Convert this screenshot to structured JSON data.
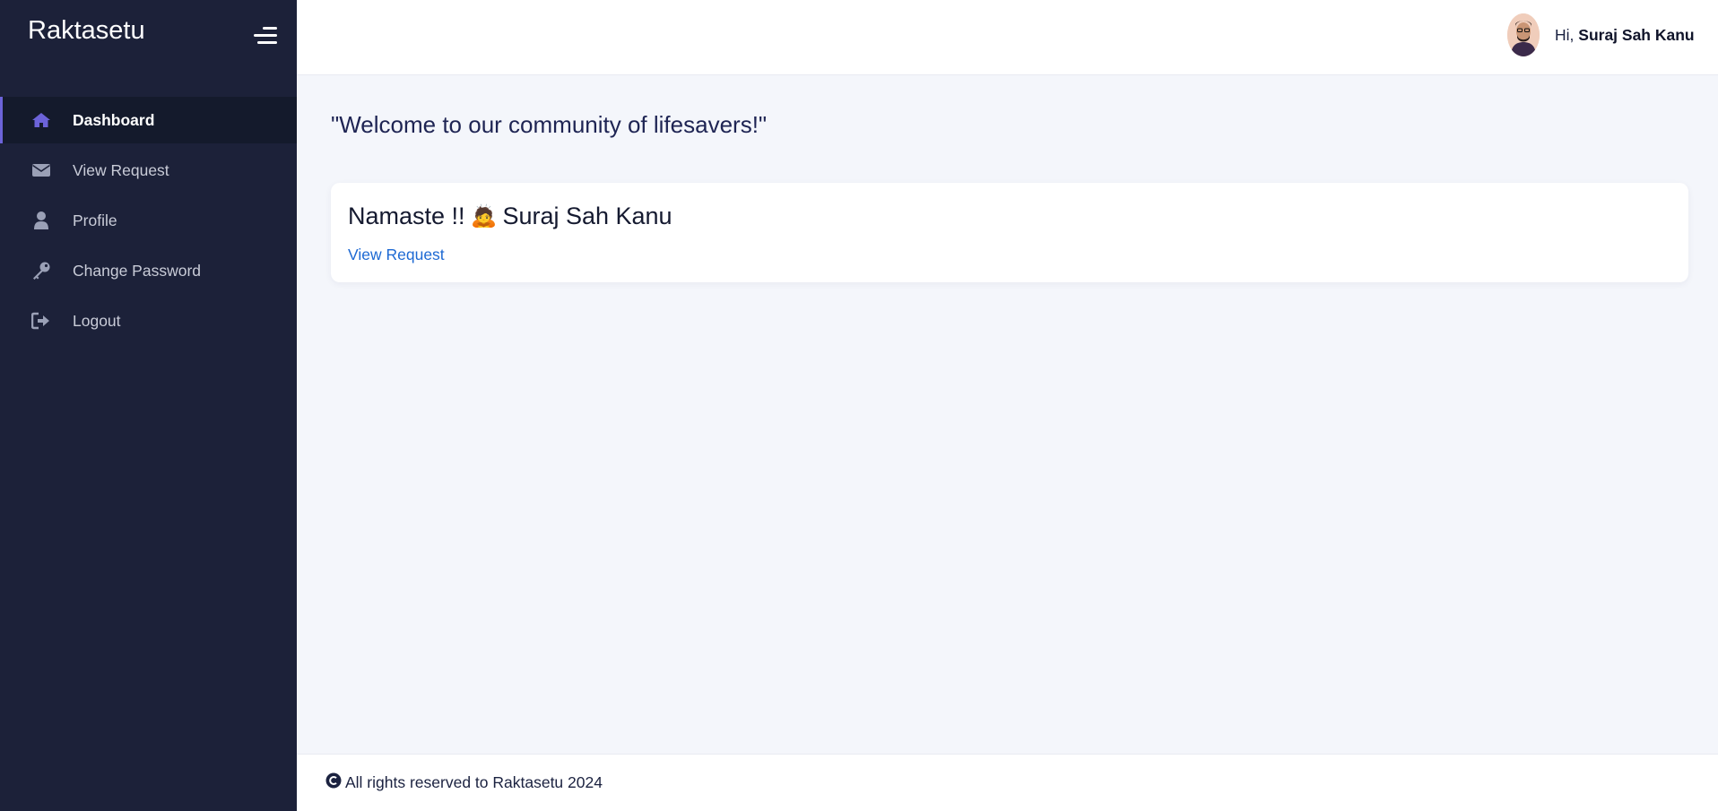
{
  "app": {
    "brand": "Raktasetu"
  },
  "sidebar": {
    "items": [
      {
        "label": "Dashboard",
        "icon": "home-icon",
        "active": true
      },
      {
        "label": "View Request",
        "icon": "envelope-icon",
        "active": false
      },
      {
        "label": "Profile",
        "icon": "user-icon",
        "active": false
      },
      {
        "label": "Change Password",
        "icon": "key-icon",
        "active": false
      },
      {
        "label": "Logout",
        "icon": "sign-out-icon",
        "active": false
      }
    ]
  },
  "header": {
    "greeting_prefix": "Hi,",
    "user_name": "Suraj Sah Kanu"
  },
  "main": {
    "welcome": "\"Welcome to our community of lifesavers!\"",
    "card": {
      "greeting": "Namaste !!",
      "emoji": "🙇",
      "name": "Suraj Sah Kanu",
      "link": "View Request"
    }
  },
  "footer": {
    "text": "All rights reserved to Raktasetu 2024",
    "icon": "copyright-icon"
  },
  "colors": {
    "sidebar_bg": "#1c2139",
    "active_accent": "#6c63d9",
    "link": "#1d69d3",
    "page_bg": "#f4f6fb"
  }
}
